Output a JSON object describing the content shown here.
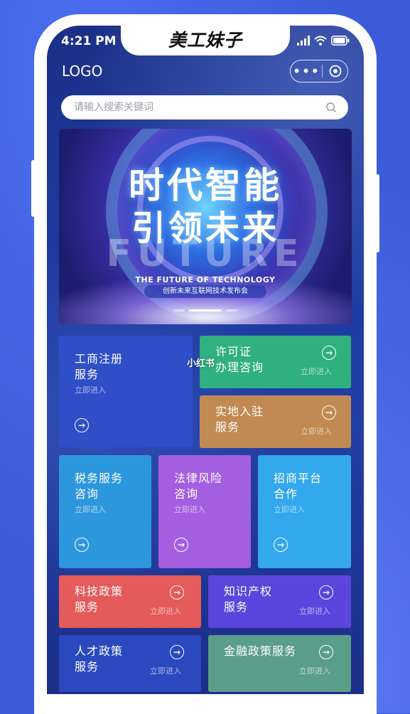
{
  "status_bar": {
    "time": "4:21 PM"
  },
  "brand_overlay": "美工妹子",
  "header": {
    "logo": "LOGO",
    "capsule_more": "•••"
  },
  "search": {
    "placeholder": "请输入搜索关键词",
    "value": ""
  },
  "banner": {
    "headline_1": "时代智能",
    "headline_2": "引领未来",
    "bg_word": "FUTURE",
    "english": "THE FUTURE OF TECHNOLOGY",
    "subtitle": "创新未来互联网技术发布会",
    "slide_count": 3,
    "active_slide": 2
  },
  "services": [
    {
      "id": "business-registration",
      "line1": "工商注册",
      "line2": "服务",
      "enter": "立即进入",
      "color": "#2f4fc8"
    },
    {
      "id": "license",
      "line1": "许可证",
      "line2": "办理咨询",
      "enter": "立即进入",
      "color": "#2fb07e"
    },
    {
      "id": "onsite",
      "line1": "实地入驻",
      "line2": "服务",
      "enter": "立即进入",
      "color": "#c08a52"
    },
    {
      "id": "tax",
      "line1": "税务服务",
      "line2": "咨询",
      "enter": "立即进入",
      "color": "#2d97dd"
    },
    {
      "id": "legal",
      "line1": "法律风险",
      "line2": "咨询",
      "enter": "立即进入",
      "color": "#a45fe0"
    },
    {
      "id": "investment",
      "line1": "招商平台",
      "line2": "合作",
      "enter": "立即进入",
      "color": "#33a8ee"
    },
    {
      "id": "tech-policy",
      "line1": "科技政策",
      "line2": "服务",
      "enter": "立即进入",
      "color": "#e55a5a"
    },
    {
      "id": "ip",
      "line1": "知识产权",
      "line2": "服务",
      "enter": "立即进入",
      "color": "#5b45dd"
    },
    {
      "id": "talent-policy",
      "line1": "人才政策",
      "line2": "服务",
      "enter": "立即进入",
      "color": "#2a49bf"
    },
    {
      "id": "finance-policy",
      "line1": "金融政策服务",
      "line2": "",
      "enter": "立即进入",
      "color": "#5a9e8a"
    }
  ],
  "watermark": "小红书",
  "icons": {
    "search": "search-icon",
    "enter": "arrow-circle-right-icon",
    "capsule_close": "target-circle-icon"
  }
}
